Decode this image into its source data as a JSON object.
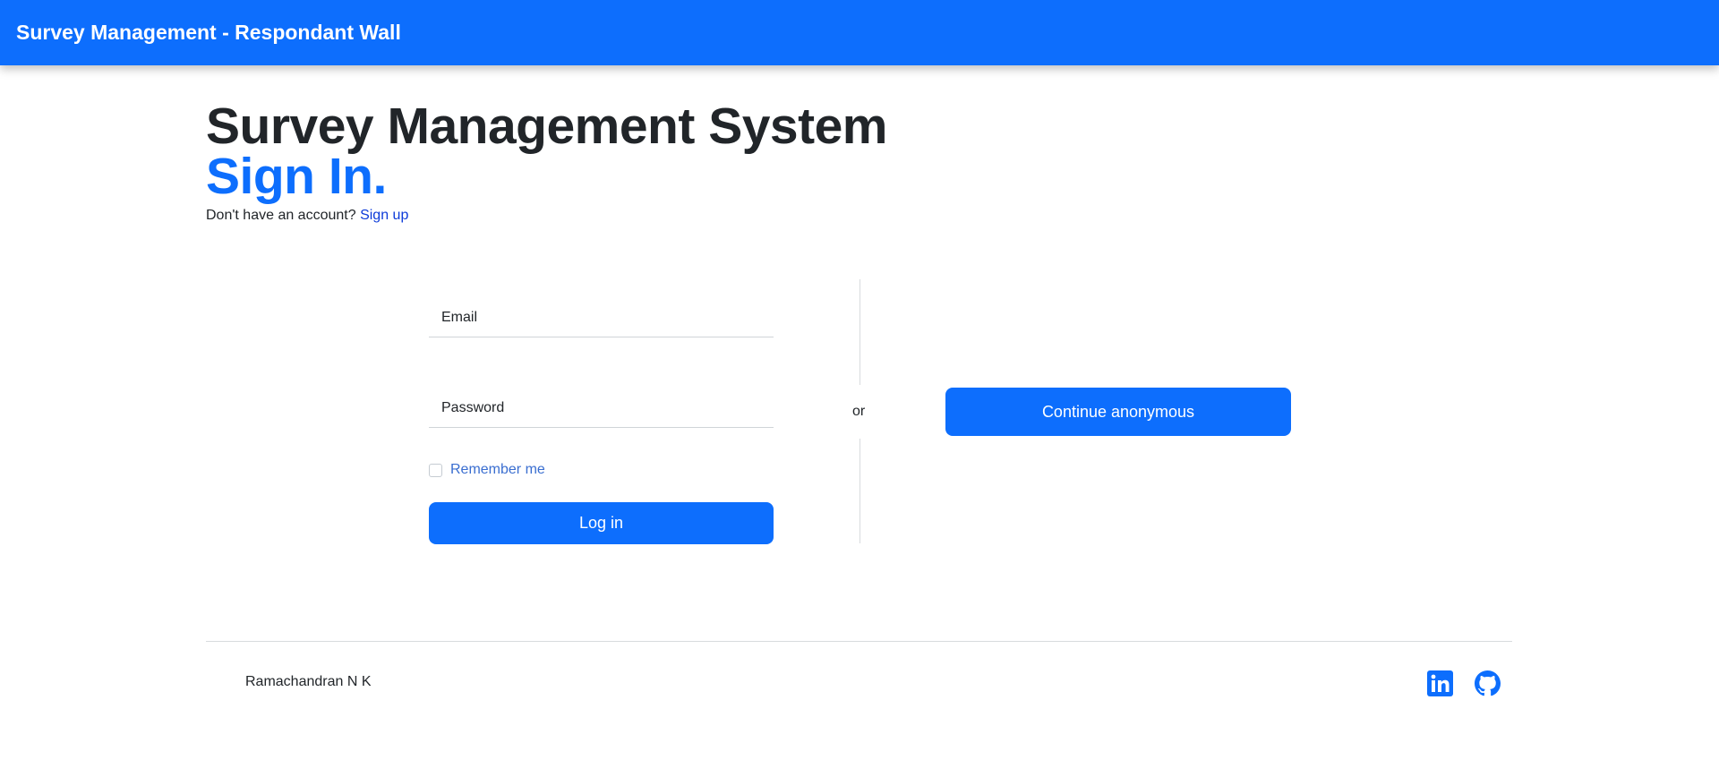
{
  "navbar": {
    "brand": "Survey Management - Respondant Wall"
  },
  "heading": {
    "title": "Survey Management System",
    "subtitle": "Sign In.",
    "signup_prompt": "Don't have an account?",
    "signup_link": "Sign up"
  },
  "login_form": {
    "email_placeholder": "Email",
    "password_placeholder": "Password",
    "remember_label": "Remember me",
    "login_button": "Log in"
  },
  "divider": {
    "or_label": "or"
  },
  "anonymous": {
    "button_label": "Continue anonymous"
  },
  "footer": {
    "author": "Ramachandran N K",
    "icons": [
      "linkedin-icon",
      "github-icon"
    ]
  },
  "colors": {
    "primary": "#0d6efd",
    "text": "#212529",
    "link": "#0d3bd9"
  }
}
